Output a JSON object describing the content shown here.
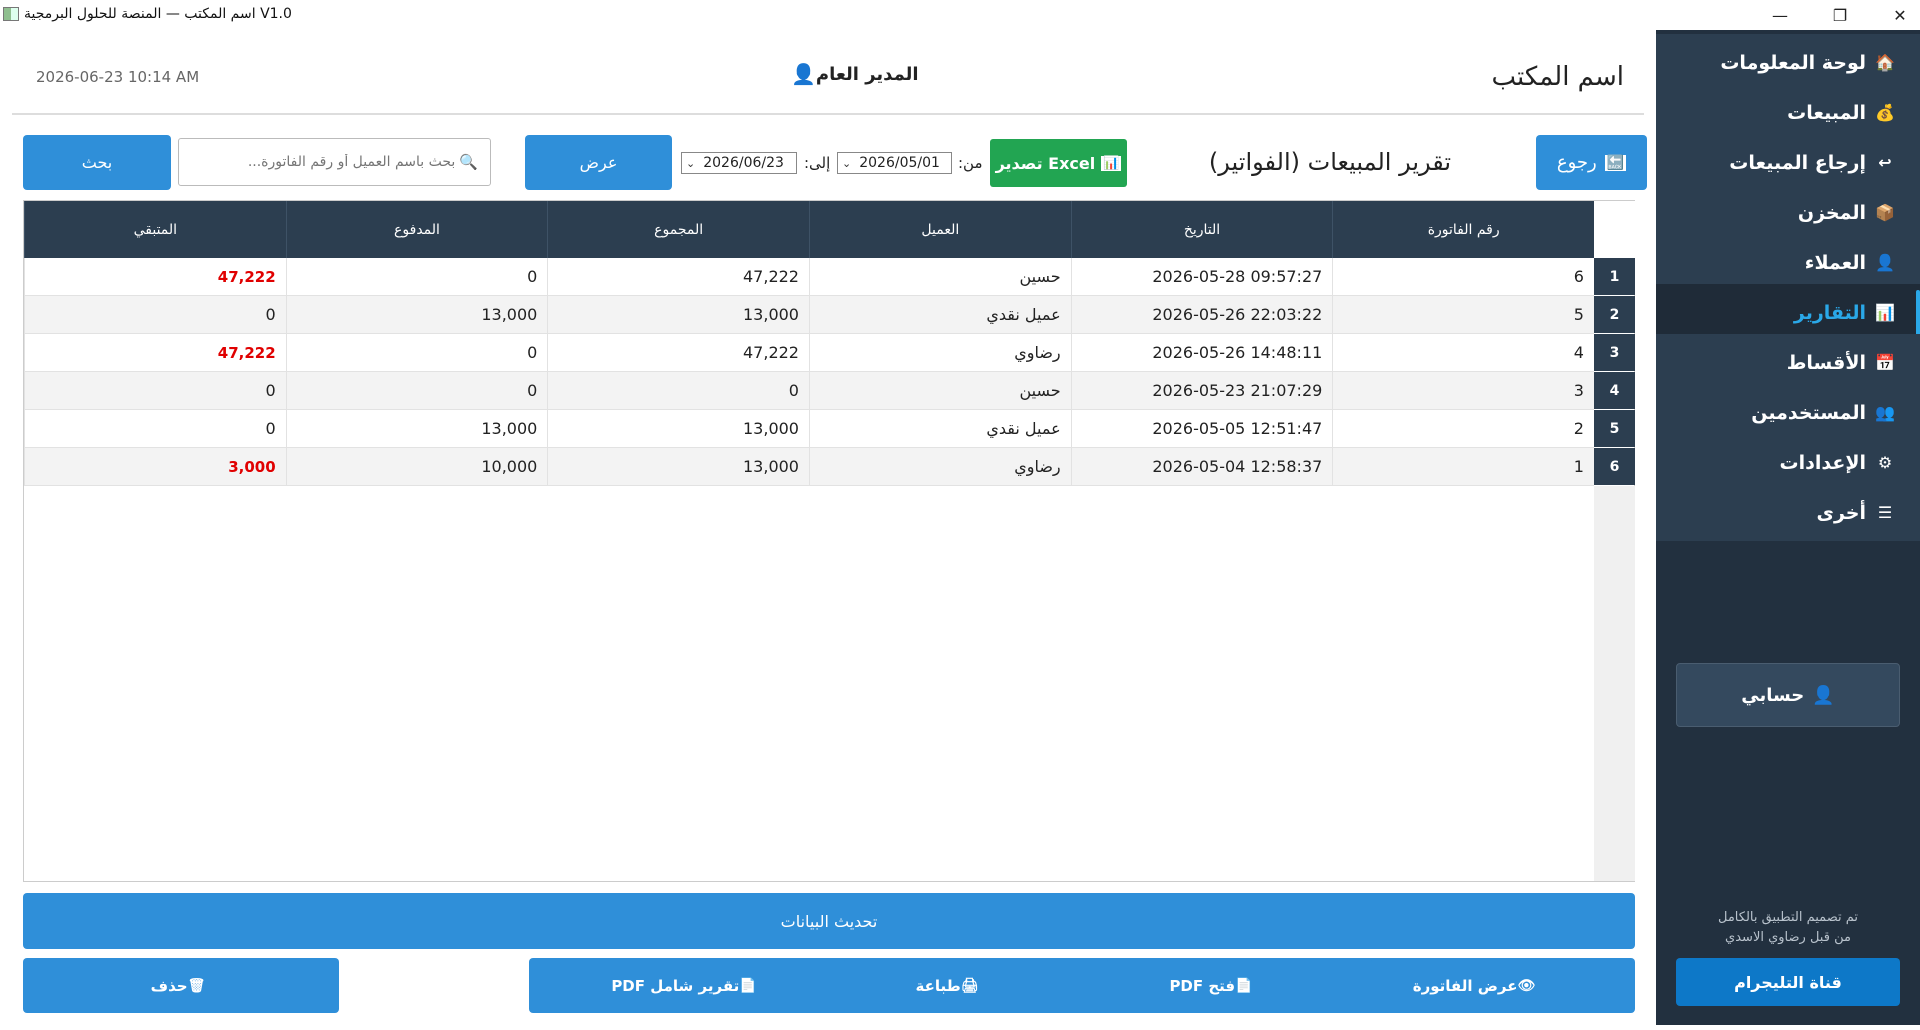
{
  "window": {
    "title": "V1.0 اسم المكتب — المنصة للحلول البرمجية",
    "minimize": "—",
    "maximize": "❐",
    "close": "✕"
  },
  "header": {
    "office_name": "اسم المكتب",
    "user_name": "المدير العام",
    "user_icon": "👤",
    "datetime": "2026-06-23  10:14 AM"
  },
  "sidebar": {
    "items": [
      {
        "label": "لوحة المعلومات",
        "icon": "🏠",
        "icon_name": "home-icon"
      },
      {
        "label": "المبيعات",
        "icon": "💰",
        "icon_name": "money-bag-icon"
      },
      {
        "label": "إرجاع المبيعات",
        "icon": "↩",
        "icon_name": "return-icon"
      },
      {
        "label": "المخزن",
        "icon": "📦",
        "icon_name": "box-icon"
      },
      {
        "label": "العملاء",
        "icon": "👤",
        "icon_name": "user-icon"
      },
      {
        "label": "التقارير",
        "icon": "📊",
        "icon_name": "chart-icon"
      },
      {
        "label": "الأقساط",
        "icon": "📅",
        "icon_name": "calendar-icon"
      },
      {
        "label": "المستخدمين",
        "icon": "👥",
        "icon_name": "users-icon"
      },
      {
        "label": "الإعدادات",
        "icon": "⚙",
        "icon_name": "gear-icon"
      },
      {
        "label": "أخرى",
        "icon": "☰",
        "icon_name": "menu-icon"
      }
    ],
    "active_index": 5,
    "account_label": "حسابي",
    "account_icon": "👤",
    "credit_line1": "تم تصميم التطبيق بالكامل",
    "credit_line2": "من قبل رضاوي الاسدي",
    "telegram_label": "قناة التليجرام"
  },
  "toolbar": {
    "back_label": "رجوع",
    "back_icon": "🔙",
    "page_title": "تقرير المبيعات (الفواتير)",
    "excel_label": "تصدير Excel",
    "excel_icon": "📊",
    "from_label": "من:",
    "from_date": "2026/05/01",
    "to_label": "إلى:",
    "to_date": "2026/06/23",
    "show_label": "عرض",
    "search_placeholder": "بحث باسم العميل أو رقم الفاتورة...",
    "search_icon": "🔍",
    "search_label": "بحث",
    "date_chevron": "⌄"
  },
  "table": {
    "columns": [
      "رقم الفاتورة",
      "التاريخ",
      "العميل",
      "المجموع",
      "المدفوع",
      "المتبقي"
    ],
    "rows": [
      {
        "num": "1",
        "invoice": "6",
        "date": "2026-05-28 09:57:27",
        "customer": "حسين",
        "total": "47,222",
        "paid": "0",
        "remaining": "47,222",
        "remaining_due": true
      },
      {
        "num": "2",
        "invoice": "5",
        "date": "2026-05-26 22:03:22",
        "customer": "عميل نقدي",
        "total": "13,000",
        "paid": "13,000",
        "remaining": "0",
        "remaining_due": false
      },
      {
        "num": "3",
        "invoice": "4",
        "date": "2026-05-26 14:48:11",
        "customer": "رضاوي",
        "total": "47,222",
        "paid": "0",
        "remaining": "47,222",
        "remaining_due": true
      },
      {
        "num": "4",
        "invoice": "3",
        "date": "2026-05-23 21:07:29",
        "customer": "حسين",
        "total": "0",
        "paid": "0",
        "remaining": "0",
        "remaining_due": false
      },
      {
        "num": "5",
        "invoice": "2",
        "date": "2026-05-05 12:51:47",
        "customer": "عميل نقدي",
        "total": "13,000",
        "paid": "13,000",
        "remaining": "0",
        "remaining_due": false
      },
      {
        "num": "6",
        "invoice": "1",
        "date": "2026-05-04 12:58:37",
        "customer": "رضاوي",
        "total": "13,000",
        "paid": "10,000",
        "remaining": "3,000",
        "remaining_due": true
      }
    ]
  },
  "actions": {
    "refresh_label": "تحديث البيانات",
    "buttons": [
      {
        "label": "عرض الفاتورة",
        "icon": "👁",
        "name": "view-invoice-button",
        "icon_name": "eye-icon"
      },
      {
        "label": "فتح PDF",
        "icon": "📄",
        "name": "open-pdf-button",
        "icon_name": "document-icon"
      },
      {
        "label": "طباعة",
        "icon": "🖨",
        "name": "print-button",
        "icon_name": "printer-icon"
      },
      {
        "label": "تقرير شامل PDF",
        "icon": "📄",
        "name": "full-report-pdf-button",
        "icon_name": "document-icon"
      },
      {
        "label": "حذف",
        "icon": "🗑",
        "name": "delete-button",
        "icon_name": "trash-icon"
      }
    ]
  },
  "colors": {
    "sidebar_bg": "#22303f",
    "nav_bg": "#2c3e50",
    "active_text": "#2aa8e8",
    "button_blue": "#2f8fd9",
    "excel_green": "#22a552",
    "telegram_blue": "#0d78c8",
    "due_red": "#e00000"
  }
}
